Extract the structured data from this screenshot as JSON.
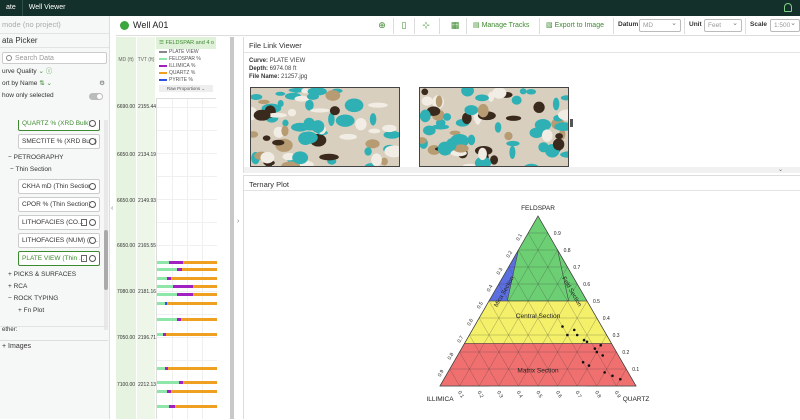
{
  "topbar": {
    "tab_left": "ate",
    "tab_right": "Well Viewer"
  },
  "left": {
    "mode": "mode (no project)",
    "title": "ata Picker",
    "search_placeholder": "Search Data",
    "curve_quality": "urve Quality",
    "sort_by": "ort by Name",
    "show_only_selected": "how only selected",
    "items": [
      {
        "type": "card",
        "label": "QUARTZ % (XRD Bulk)",
        "selected": true
      },
      {
        "type": "card",
        "label": "SMECTITE % (XRD Bulk)",
        "selected": false
      },
      {
        "type": "group",
        "label": "PETROGRAPHY"
      },
      {
        "type": "subgroup",
        "label": "Thin Section"
      },
      {
        "type": "card",
        "label": "CKHA mD (Thin Section)",
        "selected": false
      },
      {
        "type": "card",
        "label": "CPOR % (Thin Section)",
        "selected": false
      },
      {
        "type": "card",
        "label": "LITHOFACIES (CO...",
        "selected": false
      },
      {
        "type": "card",
        "label": "LITHOFACIES (NUM) (T...",
        "selected": false
      },
      {
        "type": "card",
        "label": "PLATE VIEW (Thin ...",
        "selected": true
      },
      {
        "type": "group",
        "label": "PICKS & SURFACES"
      },
      {
        "type": "group",
        "label": "RCA"
      },
      {
        "type": "group",
        "label": "ROCK TYPING"
      },
      {
        "type": "subgroup",
        "label": "Fn Plot"
      }
    ],
    "filter_label": "ether:",
    "images_label": "Images"
  },
  "wellbar": {
    "well_name": "Well A01",
    "manage_tracks": "Manage Tracks",
    "export_image": "Export to Image",
    "datum_label": "Datum",
    "datum_value": "MD",
    "unit_label": "Unit",
    "unit_value": "Feet",
    "scale_label": "Scale",
    "scale_value": "1:500"
  },
  "log": {
    "md_header": "MD (ft)",
    "tvt_header": "TVT (ft)",
    "track_title": "FELDSPAR and 4 o",
    "legend": [
      {
        "label": "PLATE VIEW",
        "color": "#888888"
      },
      {
        "label": "FELDSPAR %",
        "color": "#8ee6a8"
      },
      {
        "label": "ILLIMICA %",
        "color": "#a020c0"
      },
      {
        "label": "QUARTZ %",
        "color": "#f0a020"
      },
      {
        "label": "PYRITE %",
        "color": "#3050e0"
      }
    ],
    "raw_proportions": "Raw Proportions",
    "depths": [
      {
        "md": "6690.00",
        "tvt": "2155.44"
      },
      {
        "md": "6650.00",
        "tvt": "2134.19"
      },
      {
        "md": "6650.00",
        "tvt": "2149.93"
      },
      {
        "md": "6650.00",
        "tvt": "2165.55"
      },
      {
        "md": "7080.00",
        "tvt": "2181.16"
      },
      {
        "md": "7050.00",
        "tvt": "2196.71"
      },
      {
        "md": "7100.00",
        "tvt": "2212.13"
      }
    ]
  },
  "file_viewer": {
    "title": "File Link Viewer",
    "curve_label": "Curve:",
    "curve_value": "PLATE VIEW",
    "depth_label": "Depth:",
    "depth_value": "6974.08 ft",
    "file_label": "File Name:",
    "file_value": "21257.jpg"
  },
  "ternary": {
    "title": "Ternary Plot",
    "top_label": "FELDSPAR",
    "left_label": "ILLIMICA",
    "right_label": "QUARTZ",
    "central_label": "Central Section",
    "matrix_label": "Matrix Section",
    "left_side_label": "Mica Section",
    "right_side_label": "Feld Section",
    "colors": {
      "top": "#6ccf74",
      "left": "#5b6fe0",
      "center": "#f4f06a",
      "bottom": "#f07070"
    }
  }
}
